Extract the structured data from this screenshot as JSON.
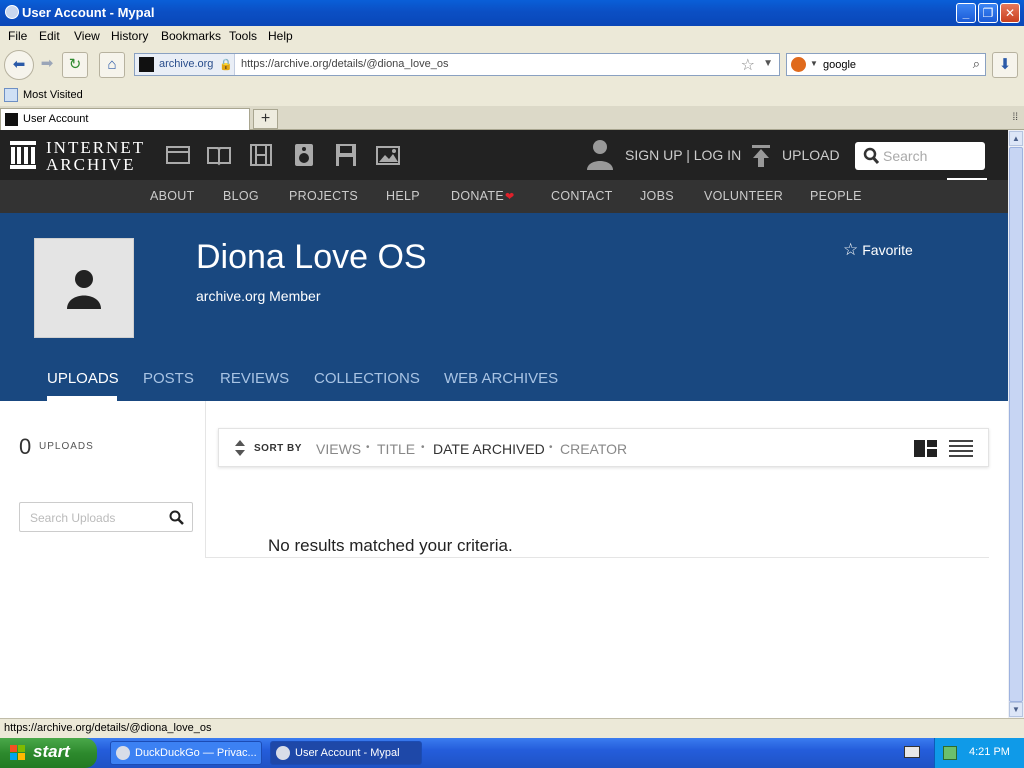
{
  "window": {
    "title": "User Account - Mypal"
  },
  "menu": [
    "File",
    "Edit",
    "View",
    "History",
    "Bookmarks",
    "Tools",
    "Help"
  ],
  "address_bar": {
    "site_label": "archive.org",
    "url": "https://archive.org/details/@diona_love_os"
  },
  "search_bar": {
    "value": "google"
  },
  "bookmarks": {
    "most_visited": "Most Visited"
  },
  "tabs": {
    "active": "User Account"
  },
  "ia": {
    "logo_line1": "INTERNET",
    "logo_line2": "ARCHIVE",
    "signup": "SIGN UP | LOG IN",
    "upload": "UPLOAD",
    "search_placeholder": "Search",
    "nav": [
      "ABOUT",
      "BLOG",
      "PROJECTS",
      "HELP",
      "DONATE",
      "CONTACT",
      "JOBS",
      "VOLUNTEER",
      "PEOPLE"
    ],
    "donate_heart": "❤"
  },
  "profile": {
    "name": "Diona Love OS",
    "subtitle": "archive.org Member",
    "favorite": "Favorite",
    "tabs": [
      "UPLOADS",
      "POSTS",
      "REVIEWS",
      "COLLECTIONS",
      "WEB ARCHIVES"
    ]
  },
  "uploads": {
    "count": "0",
    "count_label": "UPLOADS",
    "search_placeholder": "Search Uploads",
    "sort_by": "SORT BY",
    "sort_options": [
      "VIEWS",
      "TITLE",
      "DATE ARCHIVED",
      "CREATOR"
    ],
    "sort_separator": "•",
    "no_results": "No results matched your criteria."
  },
  "status_bar": {
    "text": "https://archive.org/details/@diona_love_os"
  },
  "taskbar": {
    "start": "start",
    "tasks": [
      "DuckDuckGo — Privac...",
      "User Account - Mypal"
    ],
    "time": "4:21 PM"
  },
  "colors": {
    "profile_bg": "#194880",
    "ia_top_bg": "#222222",
    "ia_nav_bg": "#333333",
    "donate_heart": "#e0202a"
  }
}
